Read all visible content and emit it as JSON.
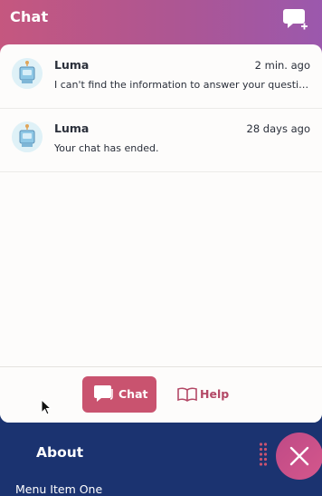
{
  "header": {
    "title": "Chat",
    "new_chat_icon": "chat-bubble-plus-icon"
  },
  "conversations": [
    {
      "name": "Luma",
      "time": "2 min. ago",
      "preview": "I can't find the information to answer your question. Could you try rephrasing it?",
      "avatar_icon": "robot-avatar-icon"
    },
    {
      "name": "Luma",
      "time": "28 days ago",
      "preview": "Your chat has ended.",
      "avatar_icon": "robot-avatar-icon"
    }
  ],
  "tabs": {
    "chat_label": "Chat",
    "chat_icon": "chat-bubble-icon",
    "help_label": "Help",
    "help_icon": "book-icon",
    "active": "chat"
  },
  "background_page": {
    "heading": "About",
    "menu_item": "Menu Item One"
  },
  "fab": {
    "icon": "close-icon"
  },
  "colors": {
    "header_gradient": [
      "#c5577f",
      "#9b58ad"
    ],
    "accent": "#c9536f",
    "page_background": "#1b3370"
  }
}
